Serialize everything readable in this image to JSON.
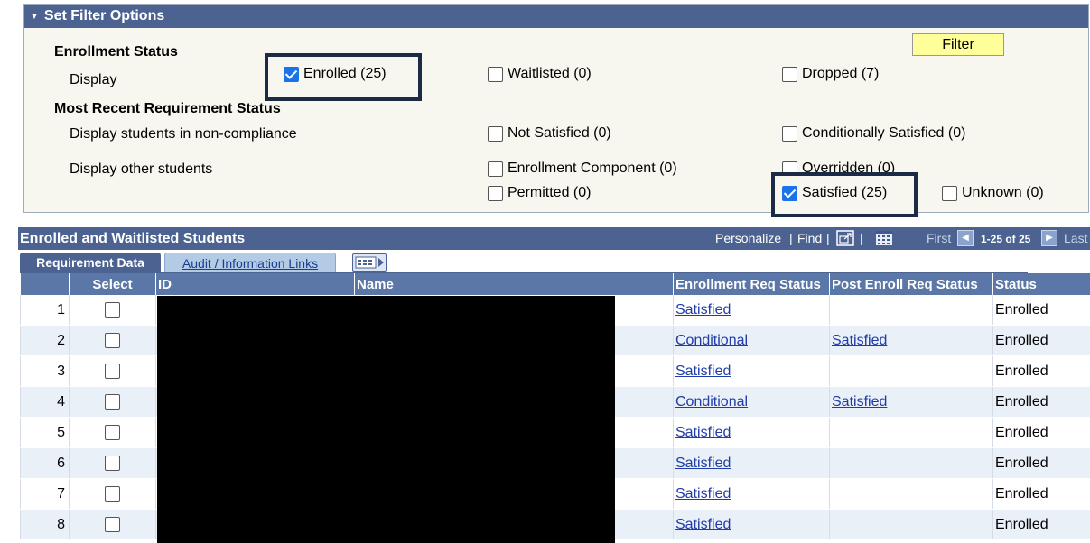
{
  "filter": {
    "title": "Set Filter Options",
    "filter_button": "Filter",
    "enrollment_status_heading": "Enrollment Status",
    "display_label": "Display",
    "enrollment_options": [
      {
        "label": "Enrolled (25)",
        "checked": true
      },
      {
        "label": "Waitlisted (0)",
        "checked": false
      },
      {
        "label": "Dropped (7)",
        "checked": false
      }
    ],
    "requirement_heading": "Most Recent Requirement Status",
    "noncompliance_label": "Display students in non-compliance",
    "noncompliance_options": [
      {
        "label": "Not Satisfied (0)",
        "checked": false
      },
      {
        "label": "Conditionally Satisfied (0)",
        "checked": false
      }
    ],
    "other_label": "Display other students",
    "other_options": [
      {
        "label": "Enrollment Component (0)",
        "checked": false
      },
      {
        "label": "Overridden (0)",
        "checked": false
      },
      {
        "label": "Permitted (0)",
        "checked": false
      },
      {
        "label": "Satisfied (25)",
        "checked": true
      },
      {
        "label": "Unknown (0)",
        "checked": false
      }
    ]
  },
  "grid": {
    "title": "Enrolled and Waitlisted Students",
    "personalize": "Personalize",
    "find": "Find",
    "separator": "|",
    "first": "First",
    "range": "1-25 of 25",
    "last": "Last",
    "tabs": [
      "Requirement Data",
      "Audit / Information Links"
    ],
    "columns": [
      "",
      "Select",
      "ID",
      "Name",
      "Enrollment Req Status",
      "Post Enroll Req Status",
      "Status"
    ],
    "rows": [
      {
        "num": "1",
        "enroll_req": "Satisfied",
        "post_req": "",
        "status": "Enrolled"
      },
      {
        "num": "2",
        "enroll_req": "Conditional",
        "post_req": "Satisfied",
        "status": "Enrolled"
      },
      {
        "num": "3",
        "enroll_req": "Satisfied",
        "post_req": "",
        "status": "Enrolled"
      },
      {
        "num": "4",
        "enroll_req": "Conditional",
        "post_req": "Satisfied",
        "status": "Enrolled"
      },
      {
        "num": "5",
        "enroll_req": "Satisfied",
        "post_req": "",
        "status": "Enrolled"
      },
      {
        "num": "6",
        "enroll_req": "Satisfied",
        "post_req": "",
        "status": "Enrolled"
      },
      {
        "num": "7",
        "enroll_req": "Satisfied",
        "post_req": "",
        "status": "Enrolled"
      },
      {
        "num": "8",
        "enroll_req": "Satisfied",
        "post_req": "",
        "status": "Enrolled"
      }
    ]
  },
  "colors": {
    "header_bg": "#4c6290",
    "panel_bg": "#f7f7ef",
    "filter_button_bg": "#ffff99",
    "link": "#1f3ca8",
    "checkbox_checked": "#1a73e8",
    "highlight_border": "#1b2a45"
  }
}
